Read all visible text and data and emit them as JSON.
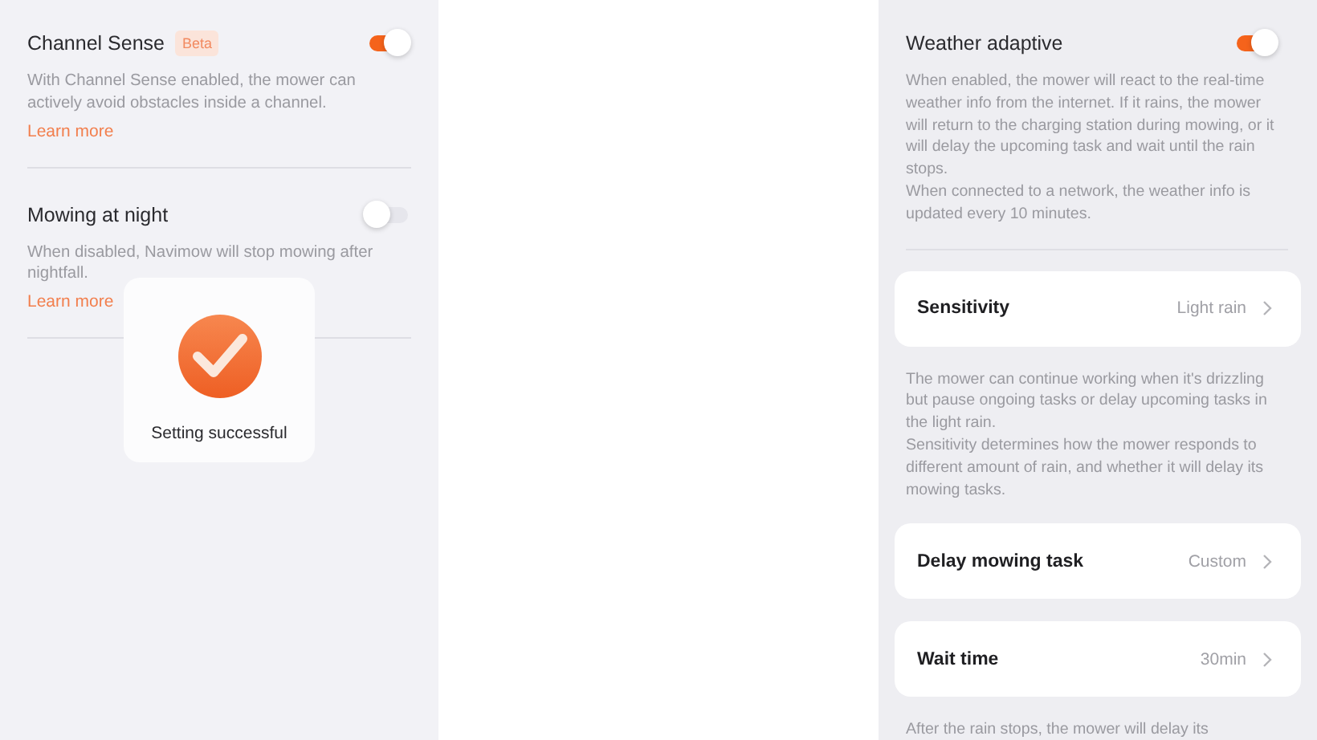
{
  "left_panel": {
    "settings": [
      {
        "title": "Channel Sense",
        "badge": "Beta",
        "on": true,
        "description": [
          "With Channel Sense enabled, the mower can actively avoid obstacles inside a channel."
        ],
        "link": "Learn more"
      },
      {
        "title": "Mowing at night",
        "on": false,
        "description": [
          "When disabled, Navimow will stop mowing after nightfall."
        ],
        "link": "Learn more"
      }
    ]
  },
  "toast": {
    "message": "Setting successful"
  },
  "right_panel": {
    "setting": {
      "title": "Weather adaptive",
      "on": true,
      "description": [
        "When enabled, the mower will react to the real-time weather info from the internet. If it rains, the mower will return to the charging station during mowing, or it will delay the upcoming task and wait until the rain stops.",
        "When connected to a network, the weather info is updated every 10 minutes."
      ]
    },
    "options": [
      {
        "label": "Sensitivity",
        "value": "Light rain",
        "description": [
          "The mower can continue working when it's drizzling but pause ongoing tasks or delay upcoming tasks in the light rain.",
          "Sensitivity determines how the mower responds to different amount of rain, and whether it will delay its mowing tasks."
        ]
      },
      {
        "label": "Delay mowing task",
        "value": "Custom"
      },
      {
        "label": "Wait time",
        "value": "30min",
        "description": [
          "After the rain stops, the mower will delay its"
        ]
      }
    ]
  }
}
